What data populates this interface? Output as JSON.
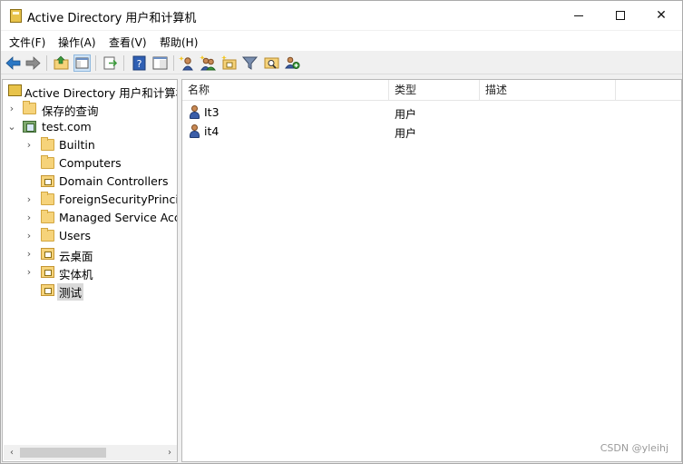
{
  "window": {
    "title": "Active Directory 用户和计算机",
    "controls": {
      "minimize": "minimize",
      "maximize": "maximize",
      "close": "✕"
    }
  },
  "menu": [
    "文件(F)",
    "操作(A)",
    "查看(V)",
    "帮助(H)"
  ],
  "toolbar": {
    "icons": [
      "back-arrow-icon",
      "forward-arrow-icon",
      "up-folder-icon",
      "show-console-tree-icon",
      "export-list-icon",
      "help-icon",
      "properties-view-icon",
      "new-user-icon",
      "new-group-icon",
      "new-ou-icon",
      "filter-icon",
      "find-icon",
      "add-to-group-icon"
    ]
  },
  "tree": {
    "root": "Active Directory 用户和计算机",
    "saved_queries": "保存的查询",
    "domain": "test.com",
    "children": [
      "Builtin",
      "Computers",
      "Domain Controllers",
      "ForeignSecurityPrincipa",
      "Managed Service Acco",
      "Users",
      "云桌面",
      "实体机",
      "测试"
    ],
    "selected": "测试"
  },
  "list": {
    "columns": [
      "名称",
      "类型",
      "描述"
    ],
    "rows": [
      {
        "name": "It3",
        "type": "用户",
        "description": ""
      },
      {
        "name": "it4",
        "type": "用户",
        "description": ""
      }
    ]
  },
  "watermark": "CSDN @yleihj",
  "colors": {
    "folder": "#f6d37a",
    "selection": "#d9d9d9",
    "accent_back": "#2b78c5"
  }
}
